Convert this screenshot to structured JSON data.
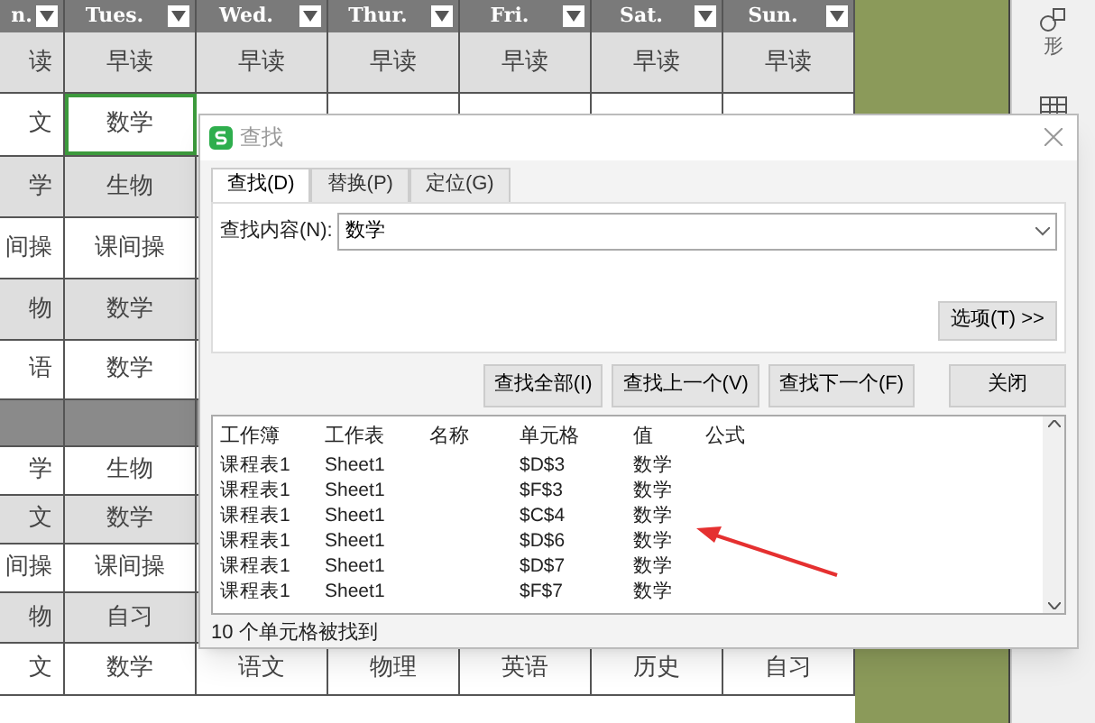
{
  "sheet": {
    "columns": [
      {
        "label": "n."
      },
      {
        "label": "Tues."
      },
      {
        "label": "Wed."
      },
      {
        "label": "Thur."
      },
      {
        "label": "Fri."
      },
      {
        "label": "Sat."
      },
      {
        "label": "Sun."
      }
    ],
    "rows": [
      {
        "kind": "lesson",
        "shaded": true,
        "cells": [
          {
            "text": "读",
            "selected": false
          },
          {
            "text": "早读",
            "selected": false
          },
          {
            "text": "早读",
            "selected": false
          },
          {
            "text": "早读",
            "selected": false
          },
          {
            "text": "早读",
            "selected": false
          },
          {
            "text": "早读",
            "selected": false
          },
          {
            "text": "早读",
            "selected": false
          }
        ]
      },
      {
        "kind": "lesson",
        "shaded": false,
        "cells": [
          {
            "text": "文",
            "selected": false
          },
          {
            "text": "数学",
            "selected": true
          }
        ]
      },
      {
        "kind": "lesson",
        "shaded": true,
        "cells": [
          {
            "text": "学",
            "selected": false
          },
          {
            "text": "生物",
            "selected": false
          }
        ]
      },
      {
        "kind": "lesson",
        "shaded": false,
        "cells": [
          {
            "text": "间操",
            "selected": false
          },
          {
            "text": "课间操",
            "selected": false
          }
        ]
      },
      {
        "kind": "lesson",
        "shaded": true,
        "cells": [
          {
            "text": "物",
            "selected": false
          },
          {
            "text": "数学",
            "selected": false
          }
        ]
      },
      {
        "kind": "lesson",
        "shaded": false,
        "cells": [
          {
            "text": "语",
            "selected": false
          },
          {
            "text": "数学",
            "selected": false
          }
        ]
      },
      {
        "kind": "break",
        "cells": []
      },
      {
        "kind": "lesson",
        "shaded": false,
        "cells": [
          {
            "text": "学",
            "selected": false
          },
          {
            "text": "生物",
            "selected": false
          }
        ]
      },
      {
        "kind": "lesson",
        "shaded": true,
        "cells": [
          {
            "text": "文",
            "selected": false
          },
          {
            "text": "数学",
            "selected": false
          }
        ]
      },
      {
        "kind": "lesson",
        "shaded": false,
        "cells": [
          {
            "text": "间操",
            "selected": false
          },
          {
            "text": "课间操",
            "selected": false
          }
        ]
      },
      {
        "kind": "lesson",
        "shaded": true,
        "cells": [
          {
            "text": "物",
            "selected": false
          },
          {
            "text": "自习",
            "selected": false
          }
        ]
      },
      {
        "kind": "lesson",
        "shaded": false,
        "cells": [
          {
            "text": "文",
            "selected": false
          },
          {
            "text": "数学",
            "selected": false
          },
          {
            "text": "语文",
            "selected": false
          },
          {
            "text": "物理",
            "selected": false
          },
          {
            "text": "英语",
            "selected": false
          },
          {
            "text": "历史",
            "selected": false
          },
          {
            "text": "自习",
            "selected": false
          }
        ]
      }
    ]
  },
  "side_panel": {
    "label": "形"
  },
  "dialog": {
    "title": "查找",
    "tabs": [
      {
        "label": "查找(D)",
        "selected": true
      },
      {
        "label": "替换(P)",
        "selected": false
      },
      {
        "label": "定位(G)",
        "selected": false
      }
    ],
    "find_label": "查找内容(N):",
    "find_value": "数学",
    "options_button": "选项(T) >>",
    "buttons": [
      "查找全部(I)",
      "查找上一个(V)",
      "查找下一个(F)"
    ],
    "close_button": "关闭",
    "results": {
      "columns": [
        "工作簿",
        "工作表",
        "名称",
        "单元格",
        "值",
        "公式"
      ],
      "rows": [
        [
          "课程表1",
          "Sheet1",
          "",
          "$D$3",
          "数学",
          ""
        ],
        [
          "课程表1",
          "Sheet1",
          "",
          "$F$3",
          "数学",
          ""
        ],
        [
          "课程表1",
          "Sheet1",
          "",
          "$C$4",
          "数学",
          ""
        ],
        [
          "课程表1",
          "Sheet1",
          "",
          "$D$6",
          "数学",
          ""
        ],
        [
          "课程表1",
          "Sheet1",
          "",
          "$D$7",
          "数学",
          ""
        ],
        [
          "课程表1",
          "Sheet1",
          "",
          "$F$7",
          "数学",
          ""
        ]
      ]
    },
    "status": "10 个单元格被找到"
  }
}
